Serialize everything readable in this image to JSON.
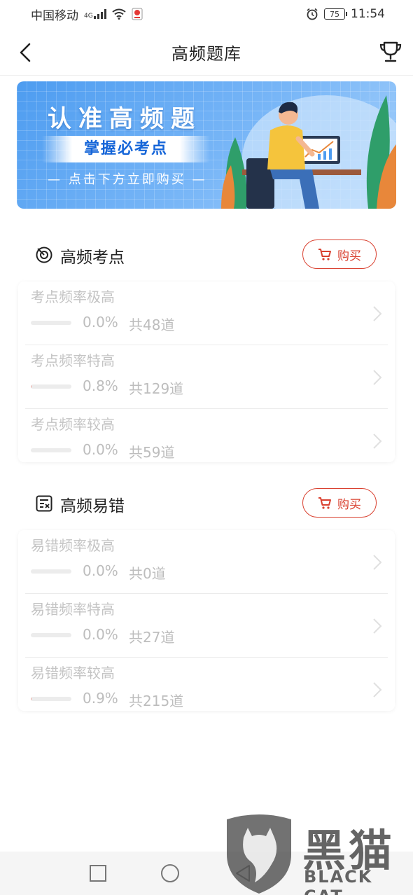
{
  "status_bar": {
    "carrier": "中国移动",
    "network": "4G",
    "battery": "75",
    "time": "11:54"
  },
  "header": {
    "title": "高频题库"
  },
  "banner": {
    "title": "认准高频题",
    "subtitle": "掌握必考点",
    "cta": "— 点击下方立即购买 —"
  },
  "sections": [
    {
      "title": "高频考点",
      "icon": "target-icon",
      "buy_label": "购买",
      "items": [
        {
          "label": "考点频率极高",
          "percent": "0.0%",
          "progress": 0.0,
          "count": "共48道"
        },
        {
          "label": "考点频率特高",
          "percent": "0.8%",
          "progress": 0.008,
          "count": "共129道"
        },
        {
          "label": "考点频率较高",
          "percent": "0.0%",
          "progress": 0.0,
          "count": "共59道"
        }
      ]
    },
    {
      "title": "高频易错",
      "icon": "error-list-icon",
      "buy_label": "购买",
      "items": [
        {
          "label": "易错频率极高",
          "percent": "0.0%",
          "progress": 0.0,
          "count": "共0道"
        },
        {
          "label": "易错频率特高",
          "percent": "0.0%",
          "progress": 0.0,
          "count": "共27道"
        },
        {
          "label": "易错频率较高",
          "percent": "0.9%",
          "progress": 0.009,
          "count": "共215道"
        }
      ]
    }
  ],
  "watermark": {
    "cn": "黑猫",
    "en": "BLACK CAT"
  },
  "colors": {
    "accent": "#d9402f",
    "banner_blue": "#4d9cf0",
    "muted_text": "#c4c4c4"
  }
}
